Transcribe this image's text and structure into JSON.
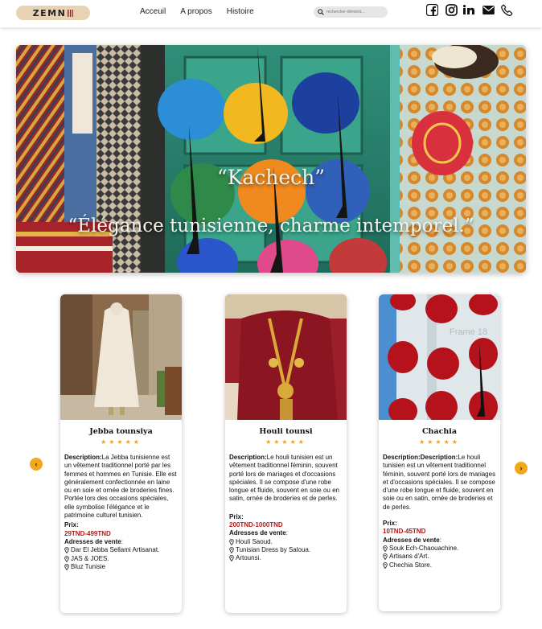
{
  "header": {
    "logo_text": "ZEMN",
    "nav": [
      "Acceuil",
      "A propos",
      "Histoire"
    ],
    "search_placeholder": "rechercher élément...",
    "social_icons": [
      "facebook-icon",
      "instagram-icon",
      "linkedin-icon",
      "mail-icon",
      "phone-icon"
    ]
  },
  "hero": {
    "title": "“Kachech”",
    "subtitle": "“Élégance tunisienne, charme intemporel.”"
  },
  "cards": [
    {
      "title": "Jebba tounsiya",
      "stars": "★★★★★",
      "desc_label": "Description:",
      "desc": "La Jebba tunisienne est un vêtement traditionnel porté par les  femmes et hommes en Tunisie. Elle est généralement confectionnée en laine ou en soie et ornée de broderies fines. Portée lors des occasions spéciales, elle symbolise l'élégance et le patrimoine culturel tunisien.",
      "prix_label": "Prix:",
      "price": "29TND-499TND",
      "addr_label": "Adresses de  vente",
      "addresses": [
        "Dar El Jebba Sellami Artisanat.",
        "JAS & JOES.",
        "Bluz Tunisie"
      ]
    },
    {
      "title": "Houli tounsi",
      "stars": "★★★★★",
      "desc_label": "Description:",
      "desc": "Le houli tunisien est un vêtement traditionnel féminin, souvent porté lors de mariages et d'occasions spéciales. Il se compose d'une robe longue et fluide, souvent en soie ou en satin, ornée de broderies et de perles.",
      "prix_label": "Prix:",
      "price": "200TND-1000TND",
      "addr_label": "Adresses de  vente",
      "addresses": [
        "Houli Saoud.",
        "Tunisian Dress by Saloua.",
        "Artounsi."
      ]
    },
    {
      "title": "Chachia",
      "stars": "★★★★★",
      "desc_label": "Description:Description:",
      "desc": "Le houli tunisien est un vêtement traditionnel féminin, souvent porté lors de mariages et d'occasions spéciales. Il se compose d'une robe longue et fluide, souvent en soie ou en satin, ornée de broderies et de perles.",
      "prix_label": "Prix:",
      "price": "10TND-45TND",
      "addr_label": "Adresses de  vente",
      "addresses": [
        "Souk Ech-Chaouachine.",
        "Artisans d'Art.",
        "Chechia Store."
      ],
      "image_watermark": "Frame 18"
    }
  ],
  "colors": {
    "accent": "#f2a81d",
    "price": "#b01818",
    "logo_bg": "#e7d3b4"
  }
}
